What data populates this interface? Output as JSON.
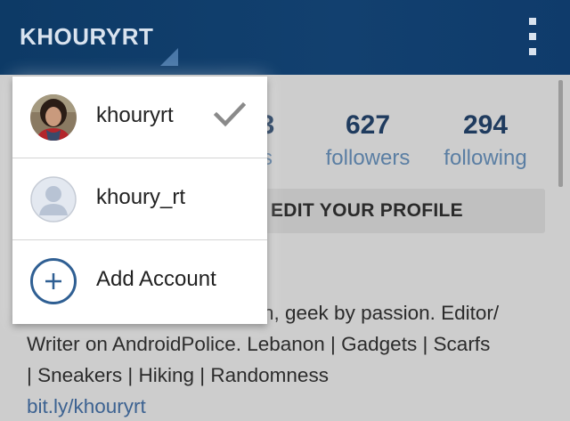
{
  "app_bar": {
    "username": "KHOURYRT",
    "icons": [
      "account-switch-triangle-icon",
      "more-vert-icon"
    ]
  },
  "accounts": [
    {
      "username": "khouryrt",
      "active": true,
      "avatar": "profile-photo-avatar",
      "icon": "check-icon"
    },
    {
      "username": "khoury_rt",
      "active": false,
      "avatar": "default-person-avatar"
    }
  ],
  "add_account": {
    "label": "Add Account",
    "icon": "plus-circle-icon"
  },
  "stats": {
    "posts_partial": "3",
    "posts_label_partial": "s",
    "followers": "627",
    "followers_label": "followers",
    "following": "294",
    "following_label": "following"
  },
  "edit_profile_label": "EDIT YOUR PROFILE",
  "bio": {
    "line1": "n, geek by passion. Editor/",
    "line2": "Writer on AndroidPolice. Lebanon | Gadgets | Scarfs",
    "line3": "| Sneakers | Hiking | Randomness",
    "link": "bit.ly/khouryrt"
  },
  "colors": {
    "app_bar": "#12406f",
    "accent": "#2f5f93",
    "stat_number": "#1f3b5e",
    "stat_label": "#5a7ea3",
    "link": "#3c6291"
  }
}
